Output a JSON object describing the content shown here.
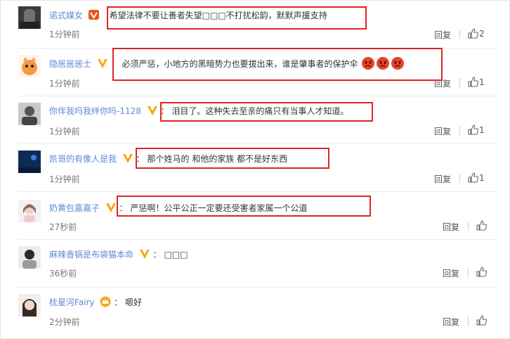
{
  "comments": [
    {
      "user": "诺式媒女",
      "text": "希望法律不要让善者失望□□□不打扰松韵，默默声援支持",
      "time": "1分钟前",
      "reply": "回复",
      "likes": "2",
      "badge": "vip-red"
    },
    {
      "user": "隐居居居士",
      "text": "必须严惩，小地方的黑暗势力也要拔出来，谁是肇事者的保护伞",
      "time": "1分钟前",
      "reply": "回复",
      "likes": "1",
      "badge": "v-gold"
    },
    {
      "user": "你伴我吗我绊你吗-1128",
      "text": "泪目了。这种失去至亲的痛只有当事人才知道。",
      "time": "1分钟前",
      "reply": "回复",
      "likes": "1",
      "badge": "v-gold"
    },
    {
      "user": "凯哥的有像人是我",
      "text": "那个姓马的 和他的家族 都不是好东西",
      "time": "1分钟前",
      "reply": "回复",
      "likes": "1",
      "badge": "v-gold"
    },
    {
      "user": "奶黄包嘉嘉子",
      "text": "严惩啊！公平公正一定要还受害者家属一个公道",
      "time": "27秒前",
      "reply": "回复",
      "likes": "",
      "badge": "v-gold"
    },
    {
      "user": "麻辣香锅是布袋猫本命",
      "text": "□□□",
      "time": "36秒前",
      "reply": "回复",
      "likes": "",
      "badge": "v-gold"
    },
    {
      "user": "枕星河Fairy",
      "text": "嗯好",
      "time": "2分钟前",
      "reply": "回复",
      "likes": "",
      "badge": "crown"
    }
  ],
  "colon": "：",
  "icons": {
    "like": "thumbs-up-icon",
    "angry": "angry-face-emoji",
    "vip": "vip-badge-icon"
  },
  "colors": {
    "username": "#5f8bd1",
    "highlight_box": "#e02426",
    "gold_badge": "#f7a700",
    "red_badge": "#e8541e"
  }
}
